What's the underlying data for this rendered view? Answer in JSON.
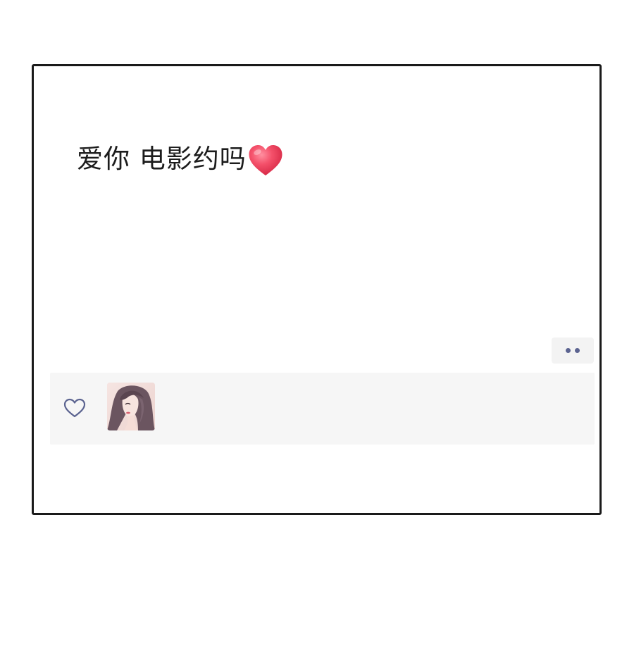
{
  "post": {
    "text": "爱你 电影约吗",
    "emoji": "red-heart"
  },
  "actions": {
    "more_icon": "ellipsis-two-dots",
    "more_dot_color": "#5b6390"
  },
  "likes": {
    "icon": "heart-outline-icon",
    "icon_color": "#5b6390",
    "avatars": [
      {
        "name": "avatar-illustrated-woman"
      }
    ]
  },
  "colors": {
    "panel_border": "#1a1a1a",
    "likes_background": "#f6f6f6",
    "heart_red": "#ef3f5a"
  }
}
